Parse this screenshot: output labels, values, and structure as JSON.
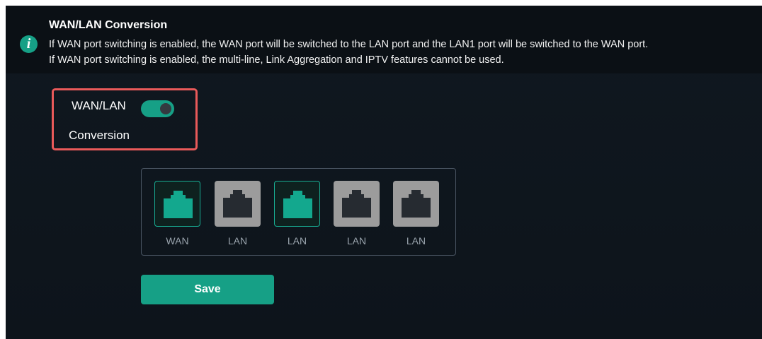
{
  "notice": {
    "title": "WAN/LAN Conversion",
    "lines": [
      "If WAN port switching is enabled, the WAN port will be switched to the LAN port and the LAN1 port will be switched to the WAN port.",
      "If WAN port switching is enabled, the multi-line, Link Aggregation and IPTV features cannot be used."
    ],
    "icon": "info-icon"
  },
  "toggle": {
    "label_line1": "WAN/LAN",
    "label_line2": "Conversion",
    "enabled": true
  },
  "ports": [
    {
      "label": "WAN",
      "active": true
    },
    {
      "label": "LAN",
      "active": false
    },
    {
      "label": "LAN",
      "active": true
    },
    {
      "label": "LAN",
      "active": false
    },
    {
      "label": "LAN",
      "active": false
    }
  ],
  "save_label": "Save",
  "colors": {
    "accent": "#16a086",
    "highlight_border": "#e95a5a",
    "background": "#101820",
    "inactive_port": "#9c9c9c"
  }
}
